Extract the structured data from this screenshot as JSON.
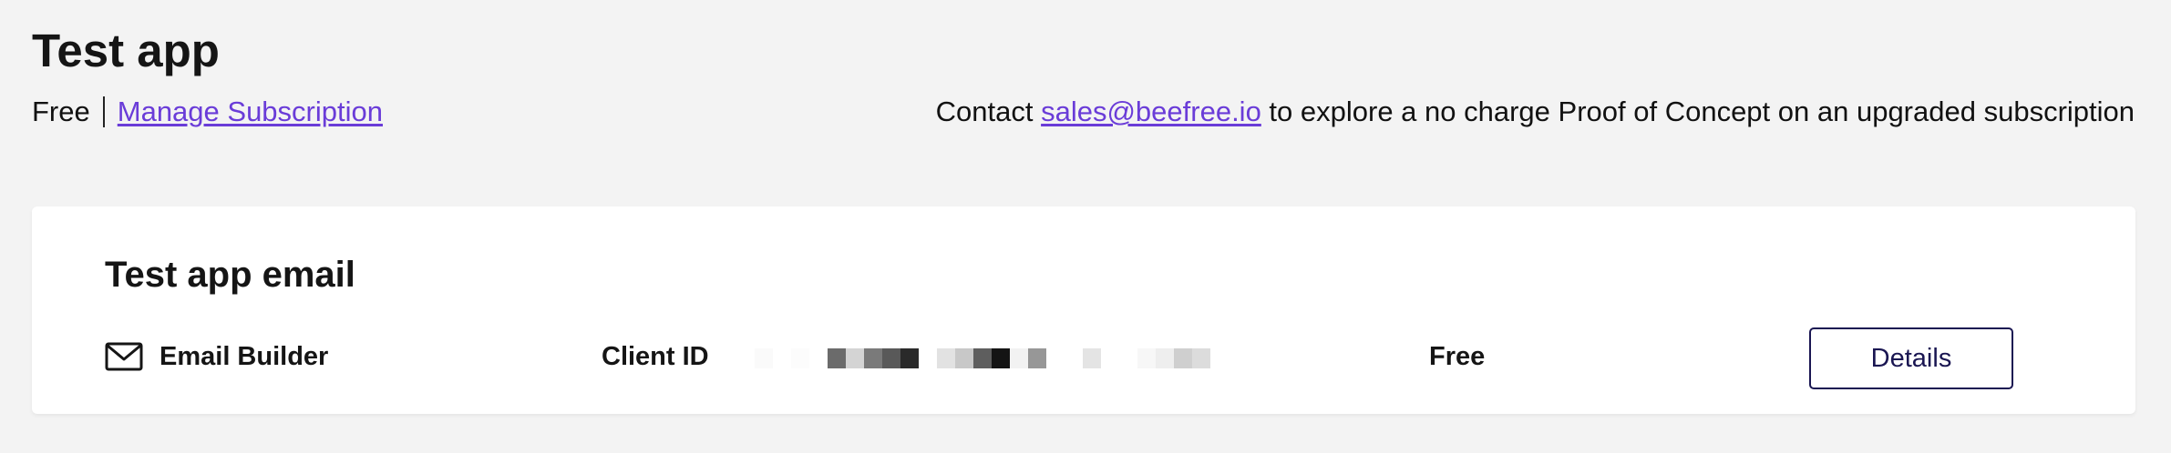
{
  "header": {
    "title": "Test app",
    "plan": "Free",
    "manage_link": "Manage Subscription",
    "contact_prefix": "Contact ",
    "contact_email": "sales@beefree.io",
    "contact_suffix": " to explore a no charge Proof of Concept on an upgraded subscription"
  },
  "card": {
    "title": "Test app email",
    "product_icon": "mail-icon",
    "product_label": "Email Builder",
    "client_id_label": "Client ID",
    "client_id_value_redacted": true,
    "plan": "Free",
    "details_label": "Details"
  },
  "colors": {
    "background": "#f3f3f3",
    "card": "#ffffff",
    "link": "#6a3cd8",
    "button_border": "#1a1652",
    "text": "#111111"
  }
}
